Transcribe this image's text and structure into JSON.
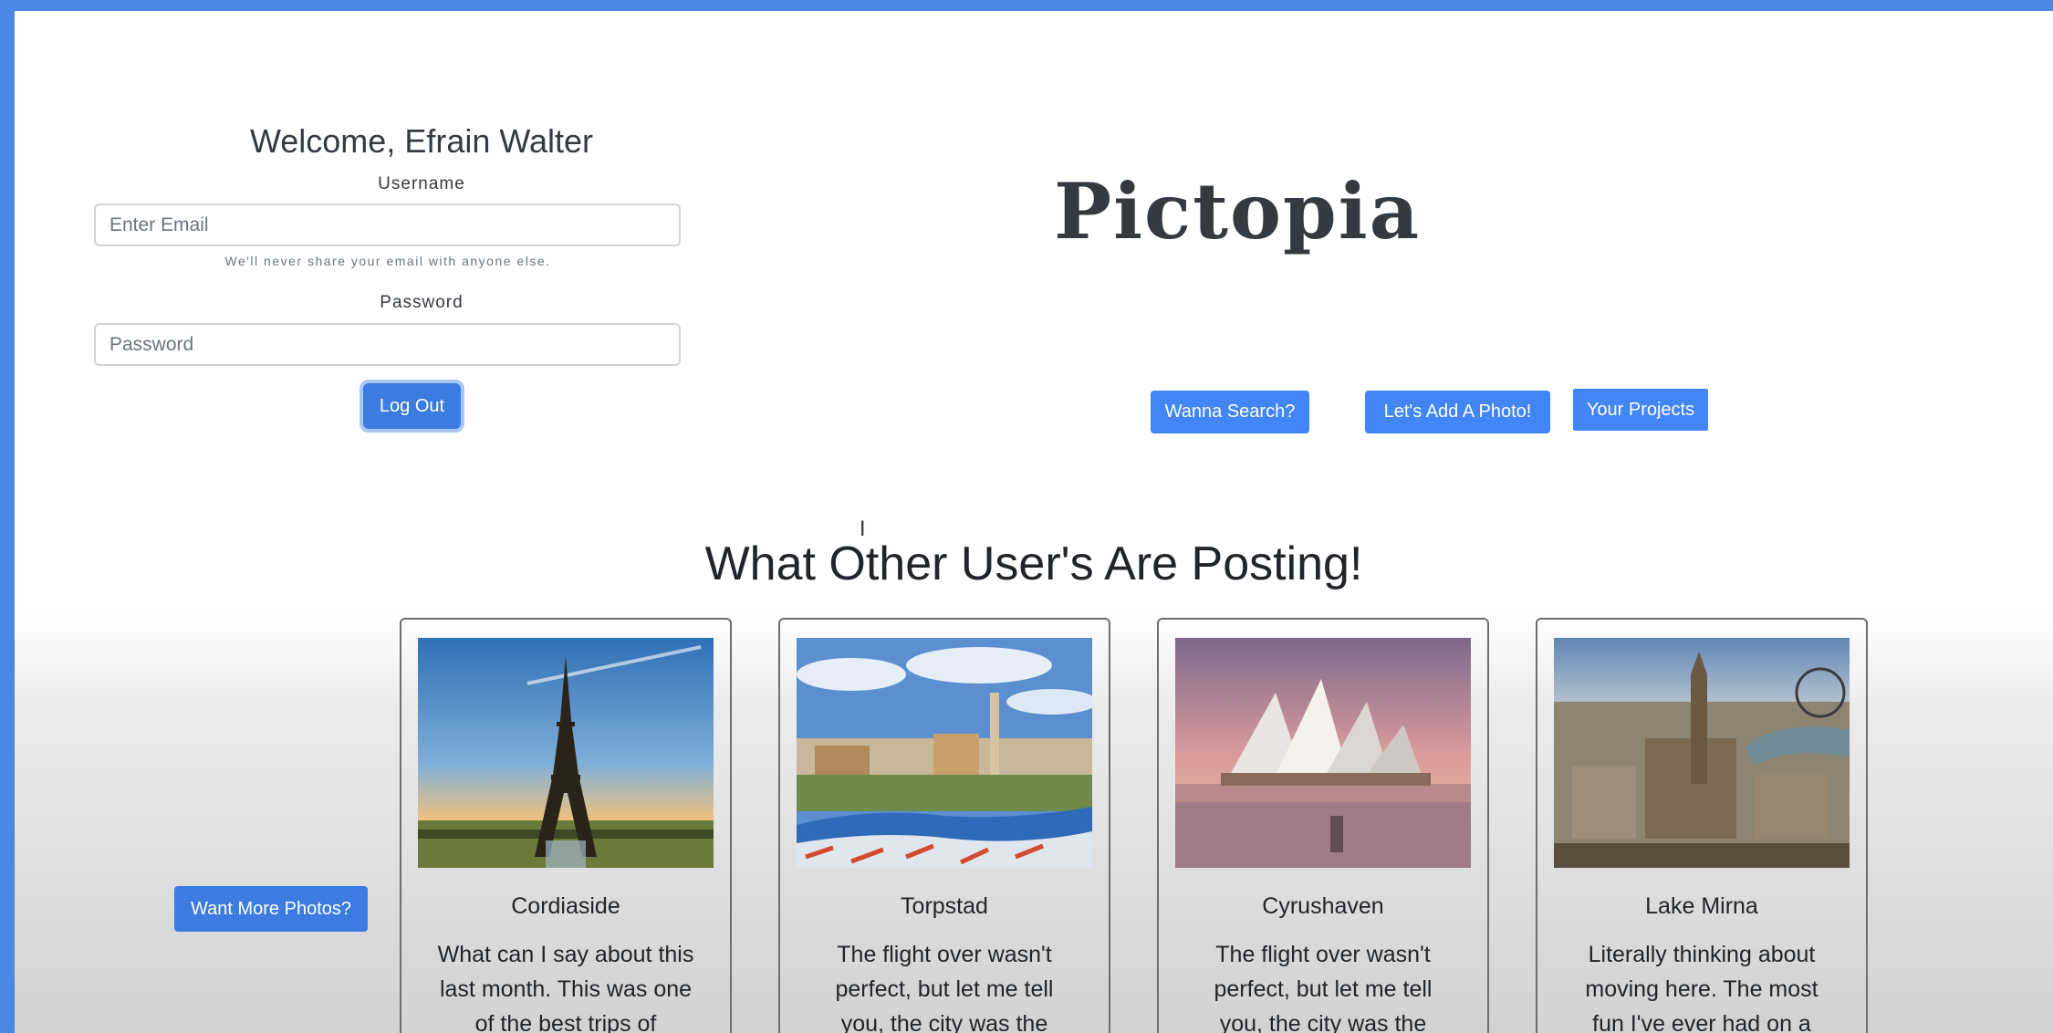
{
  "login": {
    "welcome": "Welcome, Efrain Walter",
    "username_label": "Username",
    "email_placeholder": "Enter Email",
    "email_hint": "We'll never share your email with anyone else.",
    "password_label": "Password",
    "password_placeholder": "Password",
    "logout_label": "Log Out"
  },
  "brand": "Pictopia",
  "actions": {
    "search_label": "Wanna Search?",
    "add_photo_label": "Let's Add A Photo!",
    "projects_label": "Your Projects"
  },
  "feed": {
    "title": "What Other User's Are Posting!",
    "more_label": "Want More Photos?",
    "cards": [
      {
        "city": "Cordiaside",
        "image_icon": "eiffel-tower-photo",
        "text": "What can I say about this last month. This was one of the best trips of"
      },
      {
        "city": "Torpstad",
        "image_icon": "park-guell-photo",
        "text": "The flight over wasn't perfect, but let me tell you, the city was the"
      },
      {
        "city": "Cyrushaven",
        "image_icon": "sydney-opera-house-photo",
        "text": "The flight over wasn't perfect, but let me tell you, the city was the"
      },
      {
        "city": "Lake Mirna",
        "image_icon": "london-cityscape-photo",
        "text": "Literally thinking about moving here. The most fun I've ever had on a"
      }
    ]
  },
  "colors": {
    "frame": "#4a88e6",
    "primary": "#4285f4",
    "text": "#343a40"
  }
}
